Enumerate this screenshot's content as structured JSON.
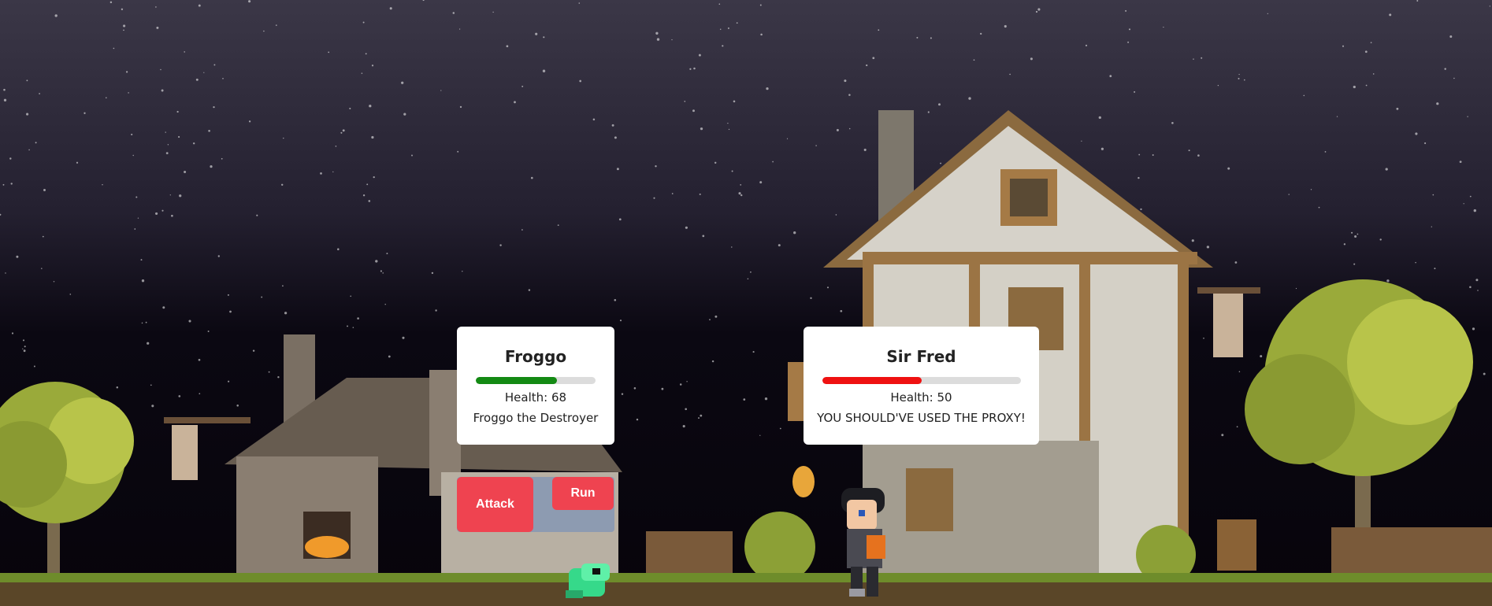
{
  "enemy": {
    "name": "Froggo",
    "health_label": "Health: 68",
    "health": 68,
    "max_health": 100,
    "description": "Froggo the Destroyer",
    "bar_color": "#138a13"
  },
  "hero": {
    "name": "Sir Fred",
    "health_label": "Health: 50",
    "health": 50,
    "max_health": 100,
    "message": "YOU SHOULD'VE USED THE PROXY!",
    "bar_color": "#ef1111"
  },
  "actions": {
    "attack_label": "Attack",
    "run_label": "Run"
  },
  "colors": {
    "button": "#ef4350",
    "panel": "#8d9bb1",
    "sky_top": "#3c3848",
    "sky_bottom": "#07040b",
    "grass": "#6b8a2a"
  },
  "scene": {
    "setting": "night village with blacksmith forge and timber-framed house"
  }
}
